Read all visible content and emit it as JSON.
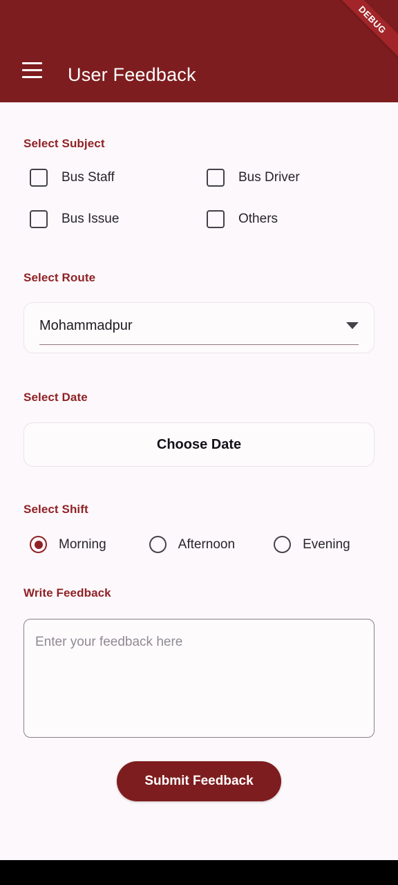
{
  "appbar": {
    "title": "User Feedback",
    "menu_icon": "hamburger-menu-icon",
    "debug_badge": "DEBUG",
    "background_color": "#7E1D1F",
    "ribbon_color": "#A22529"
  },
  "theme": {
    "accent": "#8E2226",
    "page_background": "#FDF8FB",
    "text_primary": "#26242B"
  },
  "sections": {
    "subject_label": "Select Subject",
    "route_label": "Select Route",
    "date_label": "Select Date",
    "shift_label": "Select Shift",
    "feedback_label": "Write Feedback"
  },
  "subject": {
    "options": [
      {
        "label": "Bus Staff",
        "checked": false
      },
      {
        "label": "Bus Driver",
        "checked": false
      },
      {
        "label": "Bus Issue",
        "checked": false
      },
      {
        "label": "Others",
        "checked": false
      }
    ]
  },
  "route": {
    "selected": "Mohammadpur",
    "arrow_icon": "chevron-down-icon"
  },
  "date": {
    "button_label": "Choose Date"
  },
  "shift": {
    "options": [
      {
        "label": "Morning",
        "selected": true
      },
      {
        "label": "Afternoon",
        "selected": false
      },
      {
        "label": "Evening",
        "selected": false
      }
    ]
  },
  "feedback": {
    "value": "",
    "placeholder": "Enter your feedback here"
  },
  "submit": {
    "label": "Submit Feedback"
  }
}
